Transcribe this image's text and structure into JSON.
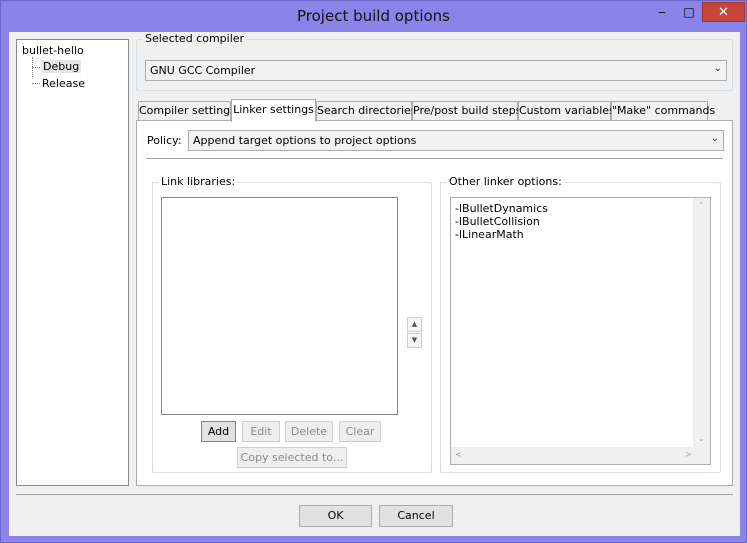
{
  "window": {
    "title": "Project build options",
    "minimize_glyph": "‒",
    "maximize_glyph": "□",
    "close_glyph": "✕"
  },
  "tree": {
    "root": "bullet-hello",
    "children": [
      "Debug",
      "Release"
    ],
    "selected": "Debug"
  },
  "compiler": {
    "group_label": "Selected compiler",
    "value": "GNU GCC Compiler"
  },
  "tabs": [
    {
      "label": "Compiler settings"
    },
    {
      "label": "Linker settings"
    },
    {
      "label": "Search directories"
    },
    {
      "label": "Pre/post build steps"
    },
    {
      "label": "Custom variables"
    },
    {
      "label": "\"Make\" commands"
    }
  ],
  "active_tab": "Linker settings",
  "policy": {
    "label": "Policy:",
    "value": "Append target options to project options"
  },
  "link_libraries": {
    "label": "Link libraries:",
    "items": [],
    "buttons": {
      "add": "Add",
      "edit": "Edit",
      "delete": "Delete",
      "clear": "Clear",
      "copy_selected": "Copy selected to..."
    }
  },
  "other_linker_options": {
    "label": "Other linker options:",
    "lines": [
      "-lBulletDynamics",
      "-lBulletCollision",
      "-lLinearMath"
    ]
  },
  "dialog_buttons": {
    "ok": "OK",
    "cancel": "Cancel"
  },
  "icons": {
    "combo_arrow": "chevron-down-icon",
    "spin_up": "up-arrow-icon",
    "spin_down": "down-arrow-icon",
    "close": "close-icon",
    "minimize": "minimize-icon",
    "maximize": "maximize-icon"
  }
}
